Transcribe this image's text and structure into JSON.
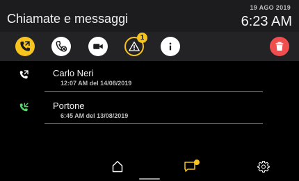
{
  "header": {
    "title": "Chiamate e messaggi",
    "date": "19 AGO 2019",
    "time": "6:23 AM"
  },
  "toolbar": {
    "alarm_badge_count": "1",
    "buttons": [
      "all-calls",
      "missed-calls",
      "video",
      "alarm",
      "info",
      "delete"
    ]
  },
  "calls": [
    {
      "name": "Carlo Neri",
      "time": "12:07 AM del 14/08/2019",
      "direction_icon": "outgoing-call-icon",
      "icon_color": "#ffffff"
    },
    {
      "name": "Portone",
      "time": "6:45 AM del 13/08/2019",
      "direction_icon": "incoming-call-icon",
      "icon_color": "#4cd964"
    }
  ],
  "nav": {
    "items": [
      "home",
      "messages",
      "settings"
    ],
    "active": "messages",
    "notification_dot": true
  },
  "colors": {
    "accent": "#f7c31e",
    "delete": "#f04e4e",
    "incoming": "#4cd964",
    "background": "#000000"
  }
}
